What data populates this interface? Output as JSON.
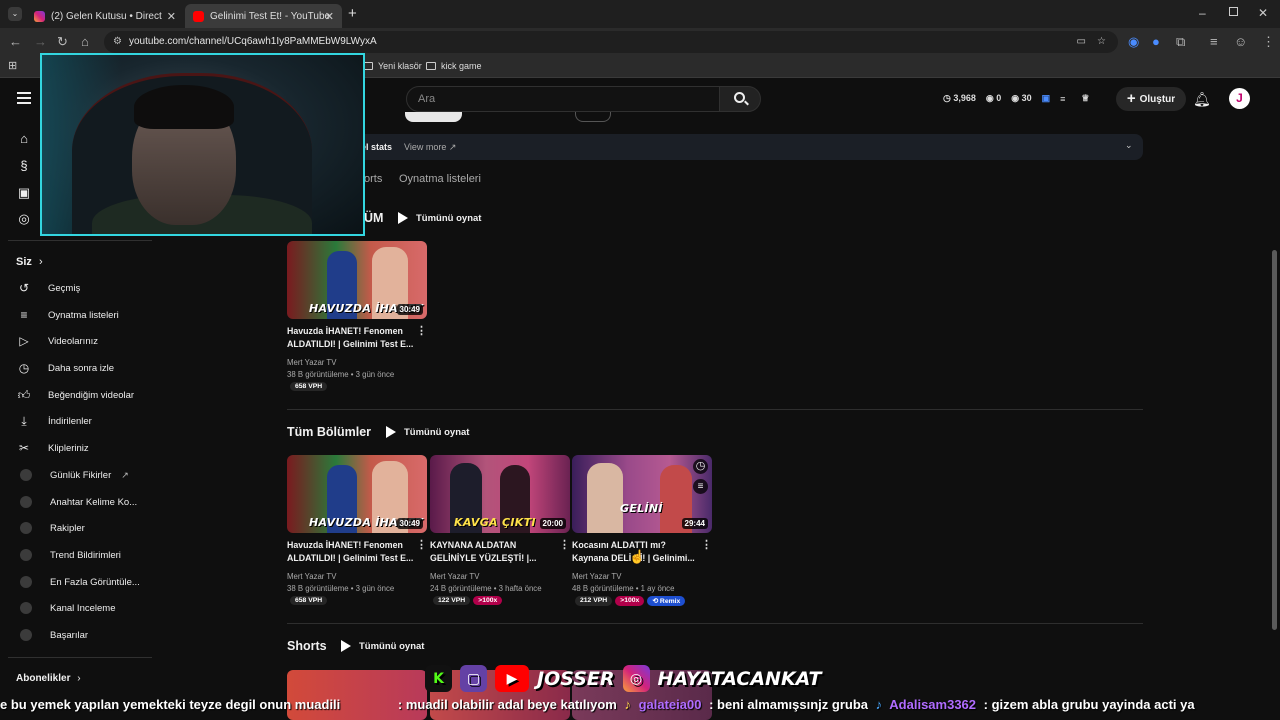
{
  "browser": {
    "tabs": [
      {
        "label": "(2) Gelen Kutusu • Direct",
        "icon": "instagram-icon",
        "active": false
      },
      {
        "label": "Gelinimi Test Et! - YouTube",
        "icon": "youtube-icon",
        "active": true
      }
    ],
    "url": "youtube.com/channel/UCq6awh1Iy8PaMMEbW9LWyxA",
    "bookmarks": [
      "Yeni klasör",
      "kick game"
    ]
  },
  "header": {
    "search_placeholder": "Ara",
    "stats": [
      "3,968",
      "0",
      "30"
    ],
    "create_label": "Oluştur",
    "avatar_letter": "J"
  },
  "sidebar": {
    "you_label": "Siz",
    "items": [
      {
        "label": "Geçmiş",
        "icon": "history-icon"
      },
      {
        "label": "Oynatma listeleri",
        "icon": "playlist-icon"
      },
      {
        "label": "Videolarınız",
        "icon": "your-videos-icon"
      },
      {
        "label": "Daha sonra izle",
        "icon": "watch-later-icon"
      },
      {
        "label": "Beğendiğim videolar",
        "icon": "liked-icon"
      },
      {
        "label": "İndirilenler",
        "icon": "download-icon"
      },
      {
        "label": "Klipleriniz",
        "icon": "scissors-icon"
      }
    ],
    "ext_items": [
      "Günlük Fikirler",
      "Anahtar Kelime Ko...",
      "Rakipler",
      "Trend Bildirimleri",
      "En Fazla Görüntüle...",
      "Kanal Inceleme",
      "Başarılar"
    ],
    "subs_label": "Abonelikler"
  },
  "channel": {
    "stats_label": "el stats",
    "view_more": "View more",
    "tabs": [
      "orts",
      "Oynatma listeleri"
    ],
    "section1_title": "ÜM",
    "play_all": "Tümünü oynat",
    "section2_title": "Tüm Bölümler",
    "shorts_title": "Shorts"
  },
  "featured": {
    "title": "Havuzda İHANET! Fenomen ALDATILDI! | Gelinimi Test E...",
    "channel": "Mert Yazar TV",
    "meta": "38 B görüntüleme • 3 gün önce",
    "duration": "30:49",
    "caption": "HAVUZDA İHANET",
    "vph": "658 VPH"
  },
  "episodes": [
    {
      "title": "Havuzda İHANET! Fenomen ALDATILDI! | Gelinimi Test E...",
      "channel": "Mert Yazar TV",
      "meta": "38 B görüntüleme • 3 gün önce",
      "duration": "30:49",
      "caption": "HAVUZDA İHANET",
      "vph": "658 VPH"
    },
    {
      "title": "KAYNANA ALDATAN GELİNİYLE YÜZLEŞTİ! |...",
      "channel": "Mert Yazar TV",
      "meta": "24 B görüntüleme • 3 hafta önce",
      "duration": "20:00",
      "caption": "KAVGA ÇIKTI",
      "vph": "122 VPH",
      "hot": ">100x"
    },
    {
      "title": "Kocasını ALDATTI mı? Kaynana DELİ Dİ! | Gelinimi...",
      "channel": "Mert Yazar TV",
      "meta": "48 B görüntüleme • 1 ay önce",
      "duration": "29:44",
      "caption": "GELİNİ",
      "vph": "212 VPH",
      "hot": ">100x",
      "remix": "Remix"
    }
  ],
  "overlay": {
    "promo": [
      "JOSSER",
      "HAYATACANKAT"
    ],
    "ticker": [
      {
        "text": "e bu yemek yapılan yemekteki teyze degil onun muadili",
        "color": "#ffffff"
      },
      {
        "text": ": muadil olabilir adal beye katılıyom",
        "color": "#ffffff"
      },
      {
        "text": "galateia00",
        "color": "#b06cff"
      },
      {
        "text": ": beni almamışsınjz gruba",
        "color": "#ffffff"
      },
      {
        "text": "Adalisam3362",
        "color": "#b06cff"
      },
      {
        "text": ": gizem abla grubu yayinda acti ya",
        "color": "#ffffff"
      }
    ]
  }
}
